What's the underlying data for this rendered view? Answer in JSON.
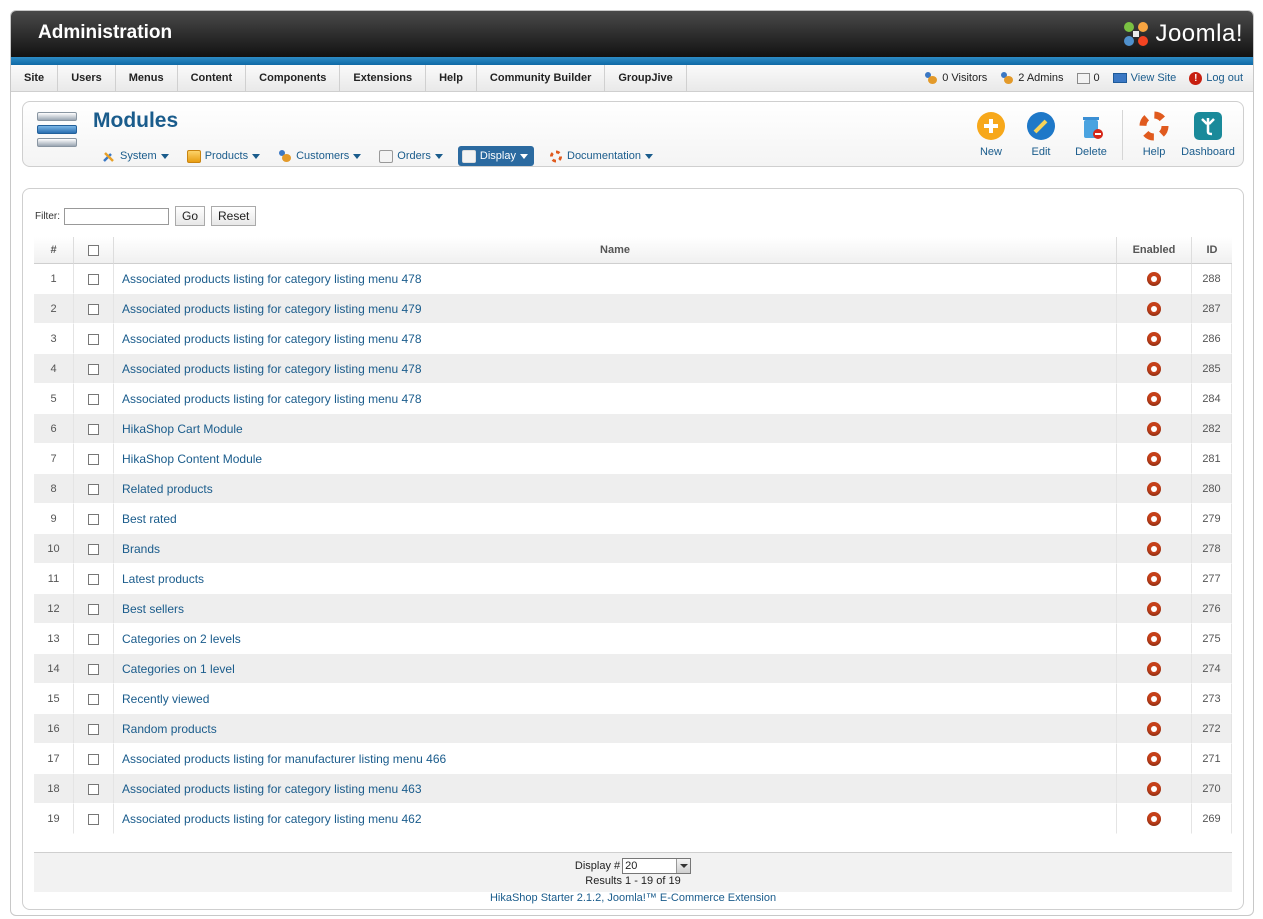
{
  "header": {
    "title": "Administration",
    "logo_text": "Joomla!"
  },
  "menu": {
    "items": [
      "Site",
      "Users",
      "Menus",
      "Content",
      "Components",
      "Extensions",
      "Help",
      "Community Builder",
      "GroupJive"
    ]
  },
  "status": {
    "visitors": "0 Visitors",
    "admins": "2 Admins",
    "messages": "0",
    "view_site": "View Site",
    "logout": "Log out"
  },
  "toolbar": {
    "title": "Modules",
    "submenu": [
      "System",
      "Products",
      "Customers",
      "Orders",
      "Display",
      "Documentation"
    ],
    "active_submenu": "Display",
    "actions": [
      "New",
      "Edit",
      "Delete",
      "Help",
      "Dashboard"
    ]
  },
  "filter": {
    "label": "Filter:",
    "value": "",
    "go": "Go",
    "reset": "Reset"
  },
  "table": {
    "headers": {
      "num": "#",
      "name": "Name",
      "enabled": "Enabled",
      "id": "ID"
    },
    "rows": [
      {
        "num": "1",
        "name": "Associated products listing for category listing menu 478",
        "id": "288"
      },
      {
        "num": "2",
        "name": "Associated products listing for category listing menu 479",
        "id": "287"
      },
      {
        "num": "3",
        "name": "Associated products listing for category listing menu 478",
        "id": "286"
      },
      {
        "num": "4",
        "name": "Associated products listing for category listing menu 478",
        "id": "285"
      },
      {
        "num": "5",
        "name": "Associated products listing for category listing menu 478",
        "id": "284"
      },
      {
        "num": "6",
        "name": "HikaShop Cart Module",
        "id": "282"
      },
      {
        "num": "7",
        "name": "HikaShop Content Module",
        "id": "281"
      },
      {
        "num": "8",
        "name": "Related products",
        "id": "280"
      },
      {
        "num": "9",
        "name": "Best rated",
        "id": "279"
      },
      {
        "num": "10",
        "name": "Brands",
        "id": "278"
      },
      {
        "num": "11",
        "name": "Latest products",
        "id": "277"
      },
      {
        "num": "12",
        "name": "Best sellers",
        "id": "276"
      },
      {
        "num": "13",
        "name": "Categories on 2 levels",
        "id": "275"
      },
      {
        "num": "14",
        "name": "Categories on 1 level",
        "id": "274"
      },
      {
        "num": "15",
        "name": "Recently viewed",
        "id": "273"
      },
      {
        "num": "16",
        "name": "Random products",
        "id": "272"
      },
      {
        "num": "17",
        "name": "Associated products listing for manufacturer listing menu 466",
        "id": "271"
      },
      {
        "num": "18",
        "name": "Associated products listing for category listing menu 463",
        "id": "270"
      },
      {
        "num": "19",
        "name": "Associated products listing for category listing menu 462",
        "id": "269"
      }
    ]
  },
  "pagination": {
    "display_label": "Display #",
    "display_value": "20",
    "results": "Results 1 - 19 of 19"
  },
  "credit": "HikaShop Starter 2.1.2, Joomla!™ E-Commerce Extension",
  "colors": {
    "link": "#1a5c8c",
    "enabled": "#c5401a",
    "header_blue": "#2d8cc6"
  }
}
